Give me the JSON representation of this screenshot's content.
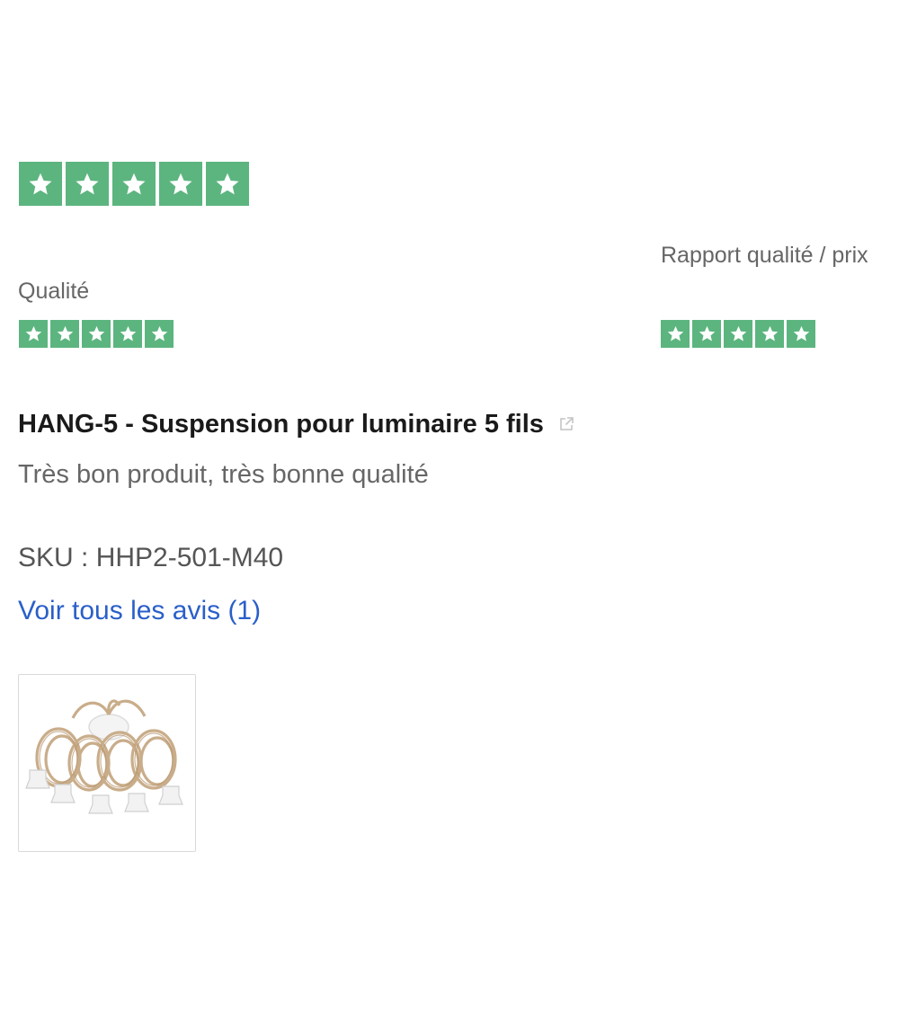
{
  "review": {
    "overall_rating": 5,
    "overall_max": 5,
    "quality": {
      "label": "Qualité",
      "rating": 5,
      "max": 5
    },
    "value_for_money": {
      "label": "Rapport qualité / prix",
      "rating": 5,
      "max": 5
    },
    "product_title": "HANG-5 - Suspension pour luminaire 5 fils",
    "text": "Très bon produit, très bonne qualité",
    "sku_line": "SKU : HHP2-501-M40",
    "see_all_link": "Voir tous les avis (1)"
  },
  "icons": {
    "star": "star-icon",
    "external_link": "external-link-icon",
    "product_image": "pendant-light-cables-image"
  },
  "colors": {
    "star_green": "#5cb57f",
    "link_blue": "#2a5fc9",
    "muted_text": "#666666"
  }
}
